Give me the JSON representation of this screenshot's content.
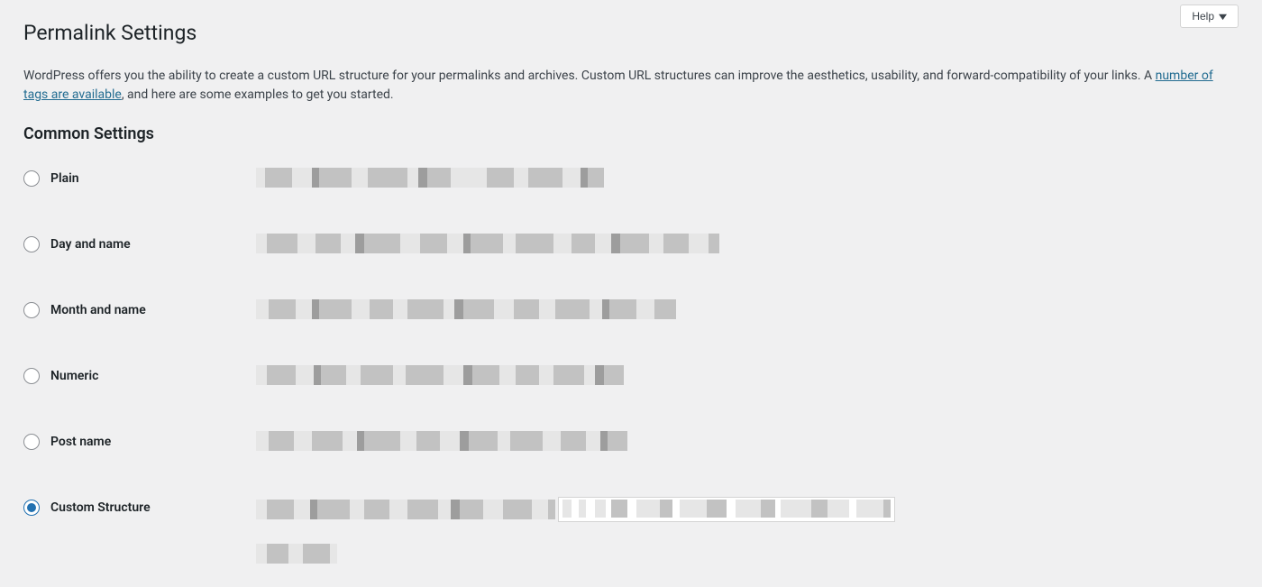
{
  "help": {
    "label": "Help"
  },
  "page": {
    "title": "Permalink Settings",
    "intro_before_link": "WordPress offers you the ability to create a custom URL structure for your permalinks and archives. Custom URL structures can improve the aesthetics, usability, and forward-compatibility of your links. A ",
    "intro_link_text": "number of tags are available",
    "intro_after_link": ", and here are some examples to get you started."
  },
  "common_settings": {
    "heading": "Common Settings",
    "options": [
      {
        "id": "plain",
        "label": "Plain",
        "checked": false
      },
      {
        "id": "day_name",
        "label": "Day and name",
        "checked": false
      },
      {
        "id": "month_name",
        "label": "Month and name",
        "checked": false
      },
      {
        "id": "numeric",
        "label": "Numeric",
        "checked": false
      },
      {
        "id": "post_name",
        "label": "Post name",
        "checked": false
      },
      {
        "id": "custom",
        "label": "Custom Structure",
        "checked": true
      }
    ]
  }
}
